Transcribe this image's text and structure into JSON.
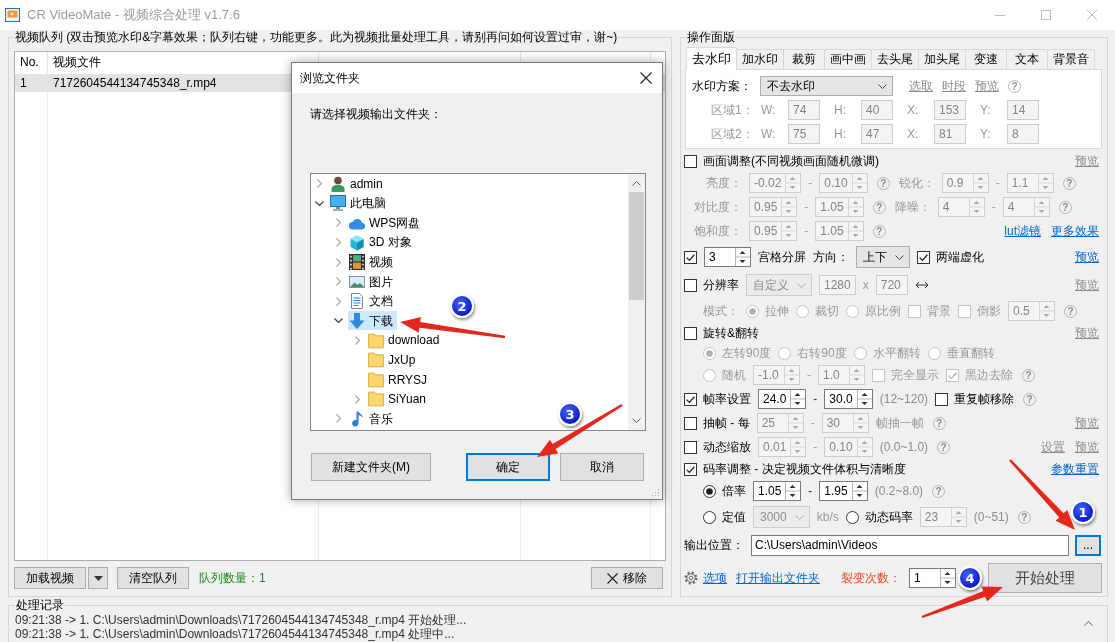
{
  "window": {
    "title": "CR VideoMate - 视频综合处理 v1.7.6"
  },
  "queue": {
    "title": "视频队列 (双击预览水印&字幕效果；队列右键，功能更多。此为视频批量处理工具，请别再问如何设置过审，谢~)",
    "columns": [
      "No.",
      "视频文件"
    ],
    "rows": [
      {
        "cells": [
          "1",
          "7172604544134745348_r.mp4"
        ],
        "selected": true
      }
    ],
    "load_button": "加载视频",
    "clear_button": "清空队列",
    "count": "队列数量：1",
    "remove_button": "移除"
  },
  "panel": {
    "title": "操作面版",
    "tabs": [
      {
        "label": "去水印",
        "selected": true
      },
      {
        "label": "加水印",
        "selected": false
      },
      {
        "label": "裁剪",
        "selected": false
      },
      {
        "label": "画中画",
        "selected": false
      },
      {
        "label": "去头尾",
        "selected": false
      },
      {
        "label": "加头尾",
        "selected": false
      },
      {
        "label": "变速",
        "selected": false
      },
      {
        "label": "文本",
        "selected": false
      },
      {
        "label": "背景音",
        "selected": false
      }
    ],
    "watermark": {
      "scheme_label": "水印方案：",
      "scheme": "不去水印",
      "links": [
        {
          "text": "选取",
          "disabled": true
        },
        {
          "text": "时段",
          "disabled": true
        },
        {
          "text": "预览",
          "disabled": true
        }
      ],
      "help": "?",
      "regions": [
        {
          "label": "区域1：",
          "disabled": true,
          "fields": [
            {
              "label": "W:",
              "value": "74"
            },
            {
              "label": "H:",
              "value": "40"
            },
            {
              "label": "X:",
              "value": "153"
            },
            {
              "label": "Y:",
              "value": "14"
            }
          ]
        },
        {
          "label": "区域2：",
          "disabled": true,
          "fields": [
            {
              "label": "W:",
              "value": "75"
            },
            {
              "label": "H:",
              "value": "47"
            },
            {
              "label": "X:",
              "value": "81"
            },
            {
              "label": "Y:",
              "value": "8"
            }
          ]
        }
      ]
    },
    "rows": [
      {
        "items": [
          {
            "kind": "check",
            "text": "画面调整(不同视频画面随机微调)",
            "checked": false,
            "disabled": false
          }
        ],
        "links": [
          {
            "text": "预览",
            "disabled": true
          }
        ]
      },
      {
        "items": [
          {
            "kind": "caption",
            "text": "亮度：",
            "disabled": true
          },
          {
            "kind": "spin",
            "value": "-0.02",
            "disabled": true
          },
          {
            "kind": "dash",
            "text": "-",
            "disabled": true
          },
          {
            "kind": "spin",
            "value": "0.10",
            "disabled": true
          },
          {
            "kind": "help",
            "text": "?"
          },
          {
            "kind": "caption",
            "text": "锐化：",
            "disabled": true
          },
          {
            "kind": "spin",
            "value": "0.9",
            "disabled": true
          },
          {
            "kind": "dash",
            "text": "-",
            "disabled": true
          },
          {
            "kind": "spin",
            "value": "1.1",
            "disabled": true
          },
          {
            "kind": "help",
            "text": "?"
          }
        ]
      },
      {
        "items": [
          {
            "kind": "caption",
            "text": "对比度：",
            "disabled": true
          },
          {
            "kind": "spin",
            "value": "0.95",
            "disabled": true
          },
          {
            "kind": "dash",
            "text": "-",
            "disabled": true
          },
          {
            "kind": "spin",
            "value": "1.05",
            "disabled": true
          },
          {
            "kind": "help",
            "text": "?"
          },
          {
            "kind": "caption",
            "text": "降噪：",
            "disabled": true
          },
          {
            "kind": "spin",
            "value": "4",
            "disabled": true
          },
          {
            "kind": "dash",
            "text": "-",
            "disabled": true
          },
          {
            "kind": "spin",
            "value": "4",
            "disabled": true
          },
          {
            "kind": "help",
            "text": "?"
          }
        ]
      },
      {
        "items": [
          {
            "kind": "caption",
            "text": "饱和度：",
            "disabled": true
          },
          {
            "kind": "spin",
            "value": "0.95",
            "disabled": true
          },
          {
            "kind": "dash",
            "text": "-",
            "disabled": true
          },
          {
            "kind": "spin",
            "value": "1.05",
            "disabled": true
          },
          {
            "kind": "help",
            "text": "?"
          }
        ],
        "links": [
          {
            "text": "lut滤镜",
            "disabled": false
          },
          {
            "text": "更多效果",
            "disabled": false
          }
        ]
      },
      {
        "items": [
          {
            "kind": "check",
            "checked": true,
            "disabled": false
          },
          {
            "kind": "spin",
            "value": "3",
            "disabled": false
          },
          {
            "kind": "text",
            "text": "宫格分屏",
            "disabled": false
          },
          {
            "kind": "text",
            "text": "方向：",
            "disabled": false
          },
          {
            "kind": "select",
            "value": "上下",
            "disabled": false
          },
          {
            "kind": "check",
            "text": "两端虚化",
            "checked": true,
            "disabled": false
          }
        ],
        "links": [
          {
            "text": "预览",
            "disabled": false
          }
        ]
      },
      {
        "items": [
          {
            "kind": "check",
            "text": "分辨率",
            "checked": false,
            "disabled": false
          },
          {
            "kind": "select",
            "value": "自定义",
            "disabled": true
          },
          {
            "kind": "field",
            "value": "1280",
            "disabled": true
          },
          {
            "kind": "text",
            "text": "x",
            "disabled": true
          },
          {
            "kind": "field",
            "value": "720",
            "disabled": true
          },
          {
            "kind": "swap"
          }
        ],
        "links": [
          {
            "text": "预览",
            "disabled": true
          }
        ]
      },
      {
        "items": [
          {
            "kind": "text",
            "text": "模式：",
            "disabled": true
          },
          {
            "kind": "radio",
            "text": "拉伸",
            "selected": true,
            "disabled": true
          },
          {
            "kind": "radio",
            "text": "裁切",
            "selected": false,
            "disabled": true
          },
          {
            "kind": "radio",
            "text": "原比例",
            "selected": false,
            "disabled": true
          },
          {
            "kind": "check",
            "text": "背景",
            "checked": false,
            "disabled": true
          },
          {
            "kind": "check",
            "text": "倒影",
            "checked": false,
            "disabled": true
          },
          {
            "kind": "spin",
            "value": "0.5",
            "disabled": true
          },
          {
            "kind": "help",
            "text": "?"
          }
        ]
      },
      {
        "items": [
          {
            "kind": "check",
            "text": "旋转&翻转",
            "checked": false,
            "disabled": false
          }
        ],
        "links": [
          {
            "text": "预览",
            "disabled": true
          }
        ]
      },
      {
        "items": [
          {
            "kind": "radio",
            "text": "左转90度",
            "selected": true,
            "disabled": true
          },
          {
            "kind": "radio",
            "text": "右转90度",
            "selected": false,
            "disabled": true
          },
          {
            "kind": "radio",
            "text": "水平翻转",
            "selected": false,
            "disabled": true
          },
          {
            "kind": "radio",
            "text": "垂直翻转",
            "selected": false,
            "disabled": true
          }
        ]
      },
      {
        "items": [
          {
            "kind": "radio",
            "text": "随机",
            "selected": false,
            "disabled": true
          },
          {
            "kind": "spin",
            "value": "-1.0",
            "disabled": true
          },
          {
            "kind": "dash",
            "text": "-",
            "disabled": true
          },
          {
            "kind": "spin",
            "value": "1.0",
            "disabled": true
          },
          {
            "kind": "check",
            "text": "完全显示",
            "checked": false,
            "disabled": true
          },
          {
            "kind": "check",
            "text": "黑边去除",
            "checked": true,
            "disabled": true
          },
          {
            "kind": "help",
            "text": "?"
          }
        ]
      },
      {
        "items": [
          {
            "kind": "check",
            "text": "帧率设置",
            "checked": true,
            "disabled": false
          },
          {
            "kind": "spin",
            "value": "24.0",
            "disabled": false
          },
          {
            "kind": "dash",
            "text": "-",
            "disabled": false
          },
          {
            "kind": "spin",
            "value": "30.0",
            "disabled": false
          },
          {
            "kind": "hint",
            "text": "(12~120)"
          },
          {
            "kind": "check",
            "text": "重复帧移除",
            "checked": false,
            "disabled": false
          },
          {
            "kind": "help",
            "text": "?"
          }
        ]
      },
      {
        "items": [
          {
            "kind": "check",
            "text": "抽帧 - 每",
            "checked": false,
            "disabled": false
          },
          {
            "kind": "spin",
            "value": "25",
            "disabled": true
          },
          {
            "kind": "dash",
            "text": "-",
            "disabled": true
          },
          {
            "kind": "spin",
            "value": "30",
            "disabled": true
          },
          {
            "kind": "text",
            "text": "帧抽一帧",
            "disabled": true
          },
          {
            "kind": "help",
            "text": "?"
          }
        ],
        "links": [
          {
            "text": "预览",
            "disabled": true
          }
        ]
      },
      {
        "items": [
          {
            "kind": "check",
            "text": "动态缩放",
            "checked": false,
            "disabled": false
          },
          {
            "kind": "spin",
            "value": "0.01",
            "disabled": true
          },
          {
            "kind": "dash",
            "text": "-",
            "disabled": true
          },
          {
            "kind": "spin",
            "value": "0.10",
            "disabled": true
          },
          {
            "kind": "hint",
            "text": "(0.0~1.0)"
          },
          {
            "kind": "help",
            "text": "?"
          }
        ],
        "links": [
          {
            "text": "设置",
            "disabled": true
          },
          {
            "text": "预览",
            "disabled": true
          }
        ]
      },
      {
        "items": [
          {
            "kind": "check",
            "text": "码率调整 - 决定视频文件体积与清晰度",
            "checked": true,
            "disabled": false
          }
        ],
        "links": [
          {
            "text": "参数重置",
            "disabled": false
          }
        ]
      },
      {
        "items": [
          {
            "kind": "radio",
            "text": "倍率",
            "selected": true,
            "disabled": false
          },
          {
            "kind": "spin",
            "value": "1.05",
            "disabled": false
          },
          {
            "kind": "dash",
            "text": "-",
            "disabled": false
          },
          {
            "kind": "spin",
            "value": "1.95",
            "disabled": false
          },
          {
            "kind": "hint",
            "text": "(0.2~8.0)"
          },
          {
            "kind": "help",
            "text": "?"
          }
        ]
      },
      {
        "items": [
          {
            "kind": "radio",
            "text": "定值",
            "selected": false,
            "disabled": false
          },
          {
            "kind": "select",
            "value": "3000",
            "disabled": true
          },
          {
            "kind": "text",
            "text": "kb/s",
            "disabled": true
          },
          {
            "kind": "radio",
            "text": "动态码率",
            "selected": false,
            "disabled": false
          },
          {
            "kind": "spin",
            "value": "23",
            "disabled": true
          },
          {
            "kind": "hint",
            "text": "(0~51)"
          },
          {
            "kind": "help",
            "text": "?"
          }
        ]
      }
    ],
    "output": {
      "label": "输出位置：",
      "path": "C:\\Users\\admin\\Videos",
      "browse": {
        "label": "...",
        "focused": true
      }
    },
    "footer": {
      "options": "选项",
      "open_folder": "打开输出文件夹",
      "split_label": "裂变次数：",
      "split_value": "1",
      "start": "开始处理"
    }
  },
  "log": {
    "title": "处理记录",
    "lines": [
      "09:21:38 -> 1. C:\\Users\\admin\\Downloads\\7172604544134745348_r.mp4 开始处理...",
      "09:21:38 -> 1. C:\\Users\\admin\\Downloads\\7172604544134745348_r.mp4 处理中..."
    ]
  },
  "dialog": {
    "title": "浏览文件夹",
    "prompt": "请选择视频输出文件夹：",
    "tree": [
      {
        "label": "admin",
        "kind": "user",
        "expandable": true,
        "expanded": false,
        "selected": false
      },
      {
        "label": "此电脑",
        "kind": "computer",
        "expandable": true,
        "expanded": true,
        "selected": false,
        "children": [
          {
            "label": "WPS网盘",
            "kind": "cloud",
            "expandable": true,
            "expanded": false,
            "selected": false
          },
          {
            "label": "3D 对象",
            "kind": "cube",
            "expandable": true,
            "expanded": false,
            "selected": false
          },
          {
            "label": "视频",
            "kind": "video",
            "expandable": true,
            "expanded": false,
            "selected": false
          },
          {
            "label": "图片",
            "kind": "picture",
            "expandable": true,
            "expanded": false,
            "selected": false
          },
          {
            "label": "文档",
            "kind": "document",
            "expandable": true,
            "expanded": false,
            "selected": false
          },
          {
            "label": "下载",
            "kind": "download",
            "expandable": true,
            "expanded": true,
            "selected": true,
            "children": [
              {
                "label": "download",
                "kind": "folder",
                "expandable": true,
                "expanded": false,
                "selected": false
              },
              {
                "label": "JxUp",
                "kind": "folder",
                "expandable": false,
                "expanded": false,
                "selected": false
              },
              {
                "label": "RRYSJ",
                "kind": "folder",
                "expandable": false,
                "expanded": false,
                "selected": false
              },
              {
                "label": "SiYuan",
                "kind": "folder",
                "expandable": true,
                "expanded": false,
                "selected": false
              }
            ]
          },
          {
            "label": "音乐",
            "kind": "music",
            "expandable": true,
            "expanded": false,
            "selected": false
          }
        ]
      }
    ],
    "buttons": [
      {
        "label": "新建文件夹(M)",
        "focused": false
      },
      {
        "label": "确定",
        "focused": true
      },
      {
        "label": "取消",
        "focused": false
      }
    ]
  },
  "annotations": [
    {
      "label": "1"
    },
    {
      "label": "2"
    },
    {
      "label": "3"
    },
    {
      "label": "4"
    }
  ]
}
